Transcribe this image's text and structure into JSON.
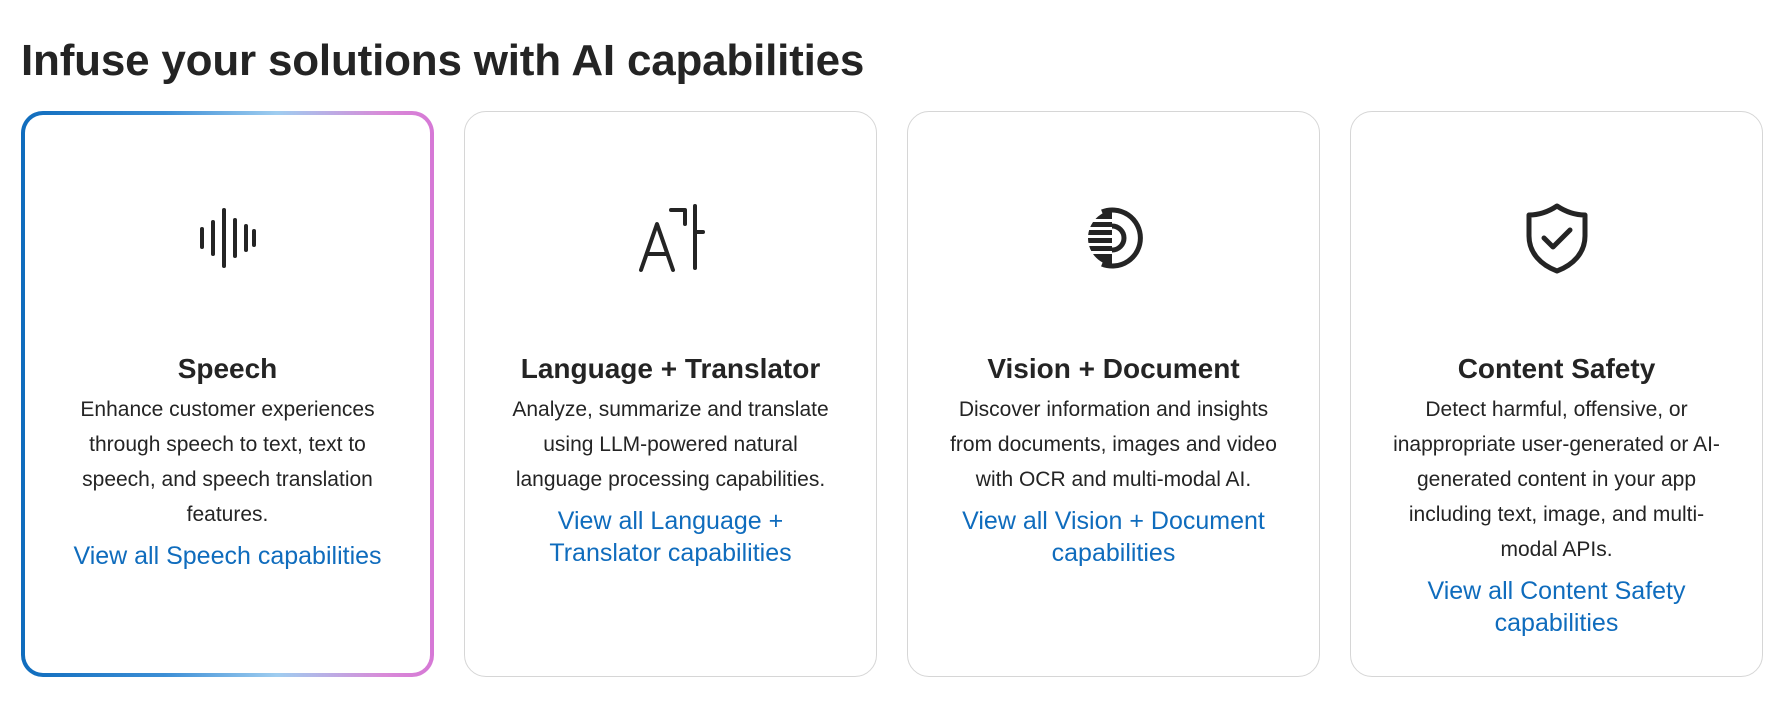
{
  "page": {
    "title": "Infuse your solutions with AI capabilities"
  },
  "colors": {
    "link": "#0f6cbd",
    "text": "#242424",
    "card_border": "#d6d6d6",
    "selected_gradient": [
      "#0f6cbd",
      "#9fcdf0",
      "#d678d6"
    ]
  },
  "cards": [
    {
      "icon": "speech-waveform-icon",
      "title": "Speech",
      "description": "Enhance customer experiences through speech to text, text to speech, and speech translation features.",
      "link": "View all Speech capabilities",
      "selected": true
    },
    {
      "icon": "language-translator-icon",
      "title": "Language + Translator",
      "description": "Analyze, summarize and translate using LLM-powered natural language processing capabilities.",
      "link": "View all Language + Translator capabilities",
      "selected": false
    },
    {
      "icon": "vision-eye-icon",
      "title": "Vision + Document",
      "description": "Discover information and insights from documents, images and video with OCR and multi-modal AI.",
      "link": "View all Vision + Document capabilities",
      "selected": false
    },
    {
      "icon": "shield-check-icon",
      "title": "Content Safety",
      "description": "Detect harmful, offensive, or inappropriate user-generated or AI-generated content in your app including text, image, and multi-modal APIs.",
      "link": "View all Content Safety capabilities",
      "selected": false
    }
  ]
}
